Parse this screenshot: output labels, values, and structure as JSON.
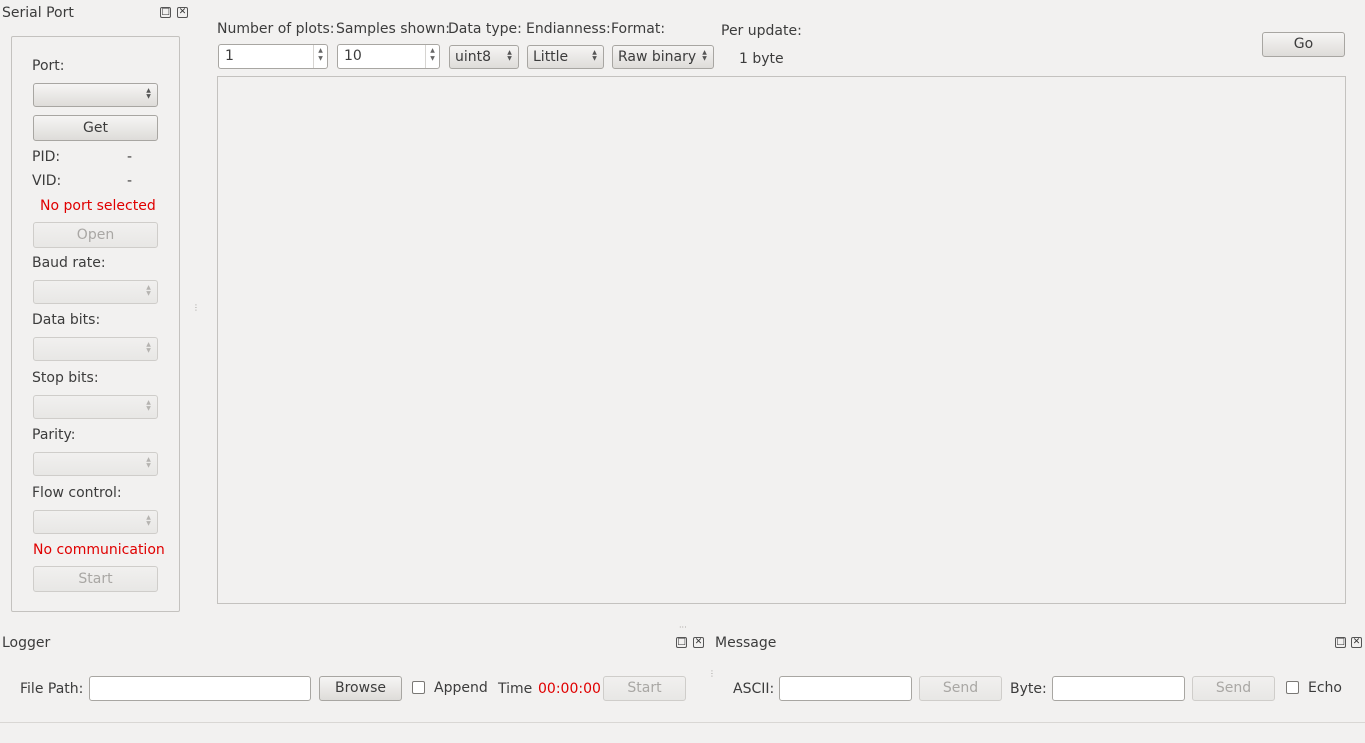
{
  "serial_dock": {
    "title": "Serial Port",
    "port_label": "Port:",
    "port_value": "",
    "get_button": "Get",
    "pid_label": "PID:",
    "pid_value": "-",
    "vid_label": "VID:",
    "vid_value": "-",
    "port_status": "No port selected",
    "open_button": "Open",
    "baud_label": "Baud rate:",
    "data_bits_label": "Data bits:",
    "stop_bits_label": "Stop bits:",
    "parity_label": "Parity:",
    "flow_label": "Flow control:",
    "comm_status": "No communication",
    "start_button": "Start"
  },
  "plot_settings": {
    "num_plots_label": "Number of plots:",
    "num_plots_value": "1",
    "samples_label": "Samples shown:",
    "samples_value": "10",
    "data_type_label": "Data type:",
    "data_type_value": "uint8",
    "endianness_label": "Endianness:",
    "endianness_value": "Little",
    "format_label": "Format:",
    "format_value": "Raw binary",
    "per_update_label": "Per update:",
    "per_update_value": "1 byte",
    "go_button": "Go"
  },
  "logger_dock": {
    "title": "Logger",
    "file_path_label": "File Path:",
    "file_path_value": "",
    "browse_button": "Browse",
    "append_label": "Append",
    "time_label": "Time",
    "time_value": "00:00:00",
    "start_button": "Start"
  },
  "message_dock": {
    "title": "Message",
    "ascii_label": "ASCII:",
    "ascii_value": "",
    "send_ascii_button": "Send",
    "byte_label": "Byte:",
    "byte_value": "",
    "send_byte_button": "Send",
    "echo_label": "Echo"
  },
  "icons": {
    "float": "float-icon",
    "close": "close-icon",
    "spin": "spin-arrows-icon"
  },
  "colors": {
    "status_red": "#e00000",
    "background": "#f2f1f0"
  }
}
